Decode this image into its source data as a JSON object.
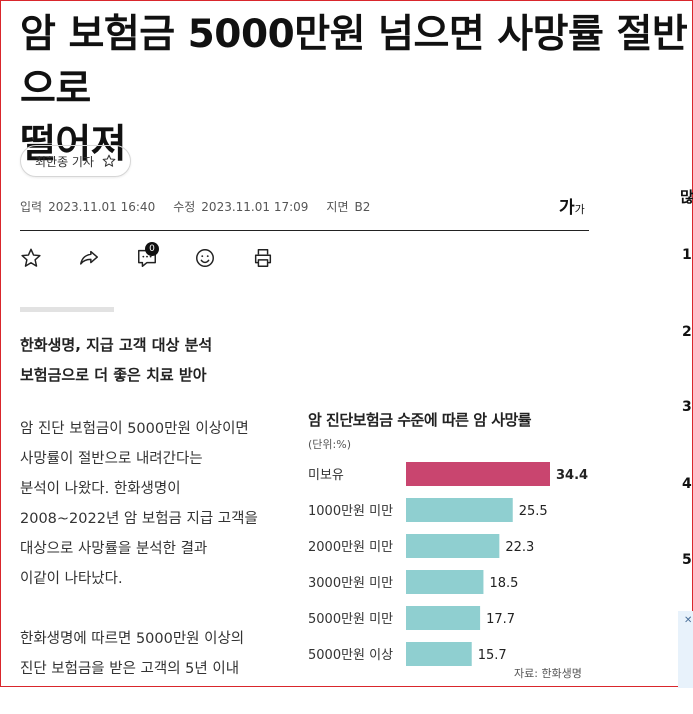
{
  "article": {
    "title": "암 보험금 5000만원 넘으면 사망률 절반으로\n떨어져",
    "reporter": "최한종 기자",
    "meta": {
      "input_label": "입력",
      "input_time": "2023.11.01 16:40",
      "edit_label": "수정",
      "edit_time": "2023.11.01 17:09",
      "page_label": "지면",
      "page_value": "B2"
    },
    "font_size_main": "가",
    "font_size_sub": "가",
    "comment_count": "0",
    "subheads": [
      "한화생명, 지급 고객 대상 분석",
      "보험금으로 더 좋은 치료 받아"
    ],
    "paragraphs": [
      [
        "암 진단 보험금이 5000만원 이상이면",
        "사망률이 절반으로 내려간다는",
        "분석이 나왔다. 한화생명이",
        "2008~2022년 암 보험금 지급 고객을",
        "대상으로 사망률을 분석한 결과",
        "이같이 나타났다."
      ],
      [
        "한화생명에 따르면 5000만원 이상의",
        "진단 보험금을 받은 고객의 5년 이내"
      ]
    ]
  },
  "chart_data": {
    "type": "bar",
    "orientation": "horizontal",
    "title": "암 진단보험금 수준에 따른 암 사망률",
    "unit": "(단위:%)",
    "source": "자료: 한화생명",
    "categories": [
      "미보유",
      "1000만원 미만",
      "2000만원 미만",
      "3000만원 미만",
      "5000만원 미만",
      "5000만원 이상"
    ],
    "values": [
      34.4,
      25.5,
      22.3,
      18.5,
      17.7,
      15.7
    ],
    "colors": [
      "#c9456f",
      "#8fcfd0",
      "#8fcfd0",
      "#8fcfd0",
      "#8fcfd0",
      "#8fcfd0"
    ],
    "xlim": [
      0,
      34.4
    ]
  },
  "right_rail": {
    "numbers": [
      "1",
      "2",
      "3",
      "4",
      "5"
    ],
    "ad_close": "✕"
  },
  "icons": [
    "star-icon",
    "share-icon",
    "comment-icon",
    "emoji-icon",
    "print-icon"
  ]
}
